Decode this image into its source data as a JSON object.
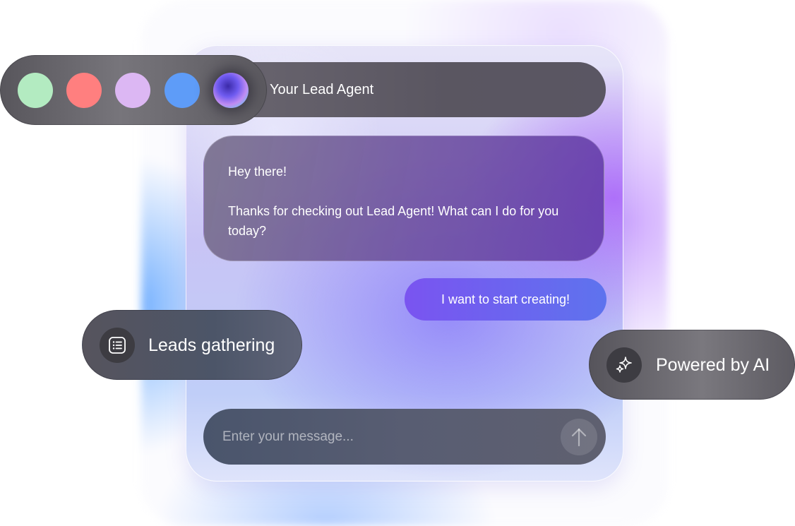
{
  "palette": {
    "swatches": [
      {
        "name": "green",
        "color": "#b3ebc1"
      },
      {
        "name": "red",
        "color": "#ff7f7f"
      },
      {
        "name": "lavender",
        "color": "#dcb7f3"
      },
      {
        "name": "blue",
        "color": "#5e9cf8"
      },
      {
        "name": "gradient-orb",
        "color": "#6f5bf0",
        "selected": true
      }
    ]
  },
  "header": {
    "title": "Your Lead Agent"
  },
  "messages": {
    "bot": {
      "greeting": "Hey there!",
      "body": "Thanks for checking out Lead Agent! What can I do for you today?"
    },
    "user": {
      "text": "I want to start creating!"
    }
  },
  "input": {
    "placeholder": "Enter your message...",
    "value": "",
    "send_icon": "arrow-up-icon"
  },
  "chips": {
    "leads": {
      "label": "Leads gathering",
      "icon": "list-icon"
    },
    "ai": {
      "label": "Powered by AI",
      "icon": "sparkle-icon"
    }
  },
  "colors": {
    "accent_purple": "#7a54f0",
    "accent_blue": "#5e73ee",
    "bar_dark": "#5a5661"
  }
}
